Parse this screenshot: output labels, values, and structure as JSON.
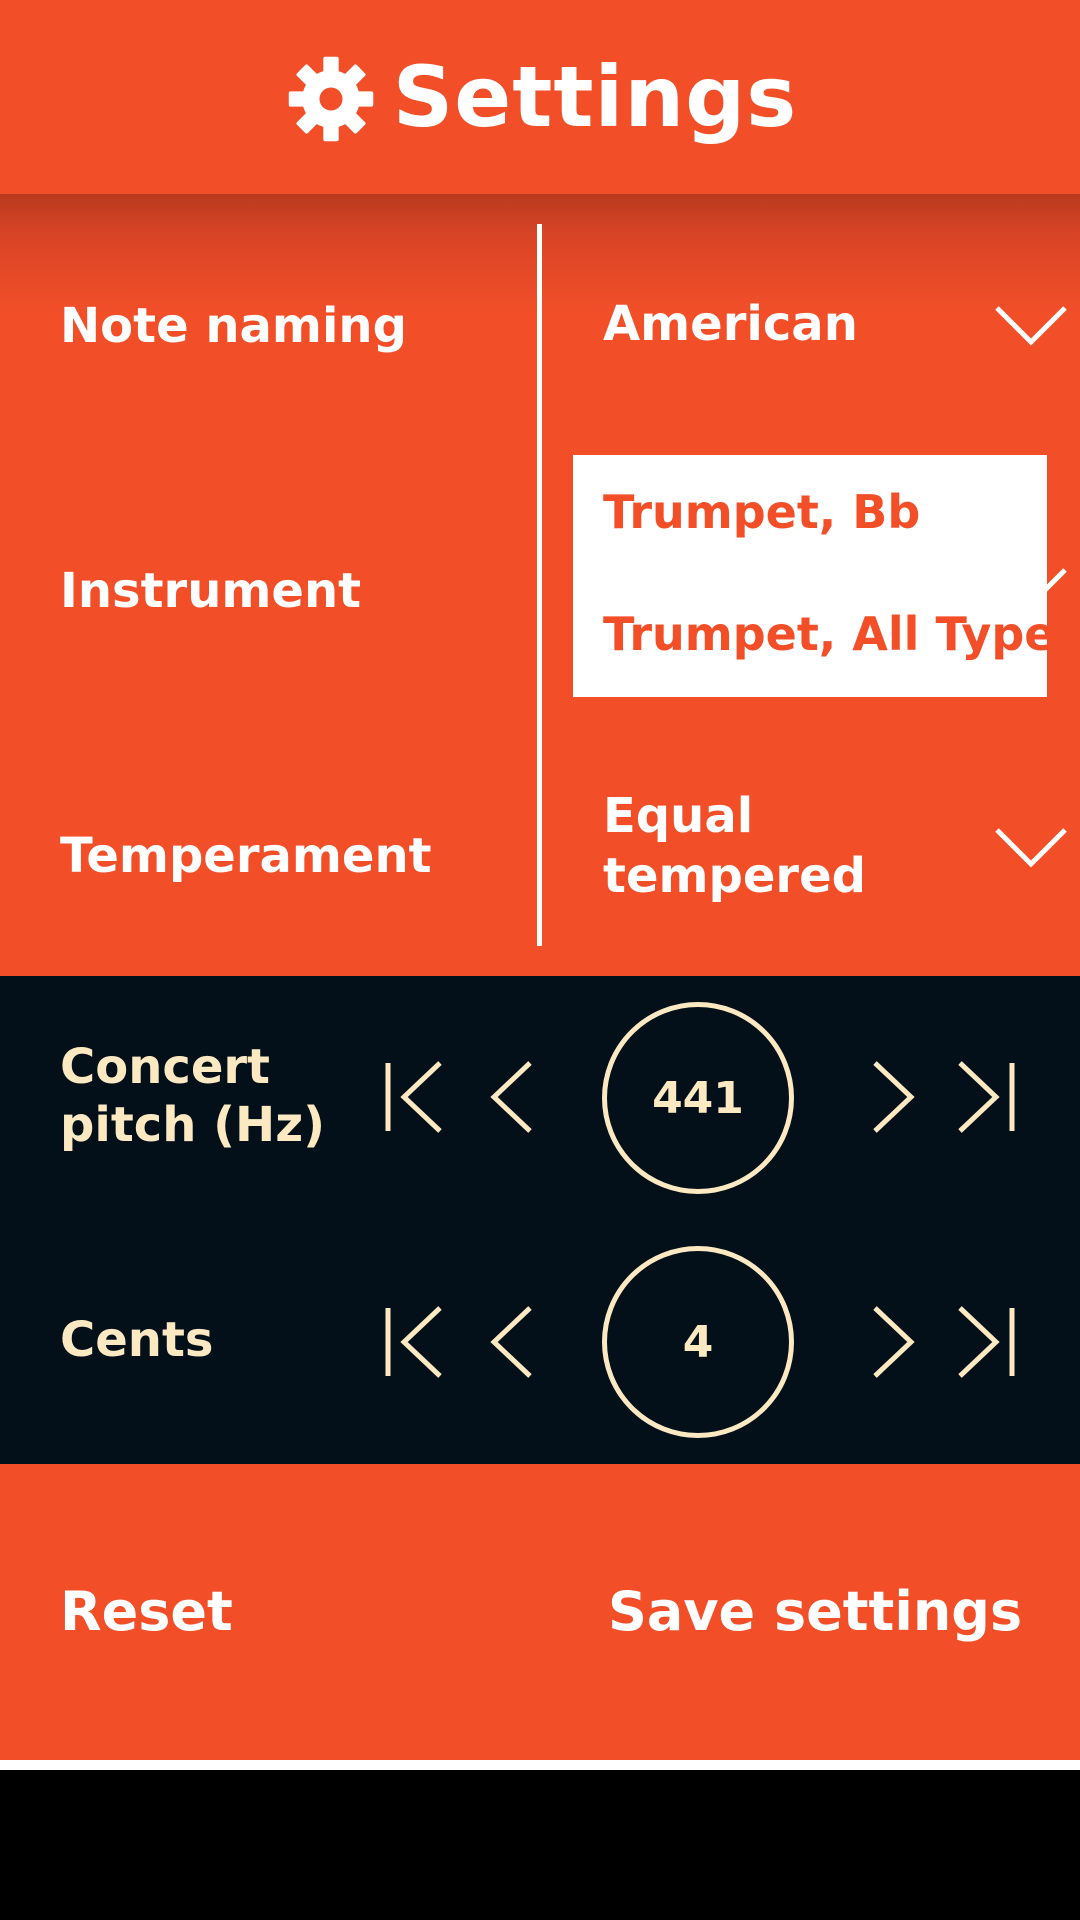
{
  "header": {
    "title": "Settings",
    "icon": "gear-icon"
  },
  "settings": {
    "note_naming": {
      "label": "Note naming",
      "value": "American"
    },
    "instrument": {
      "label": "Instrument",
      "options": [
        "Trumpet, Bb",
        "Trumpet, All Types"
      ]
    },
    "temperament": {
      "label": "Temperament",
      "value_line1": "Equal",
      "value_line2": "tempered"
    }
  },
  "tuning": {
    "concert_pitch": {
      "label_line1": "Concert",
      "label_line2": "pitch (Hz)",
      "value": "441"
    },
    "cents": {
      "label": "Cents",
      "value": "4"
    }
  },
  "actions": {
    "reset": "Reset",
    "save": "Save settings"
  },
  "colors": {
    "accent": "#f24f28",
    "dark": "#03101a",
    "cream": "#fce9c2"
  }
}
